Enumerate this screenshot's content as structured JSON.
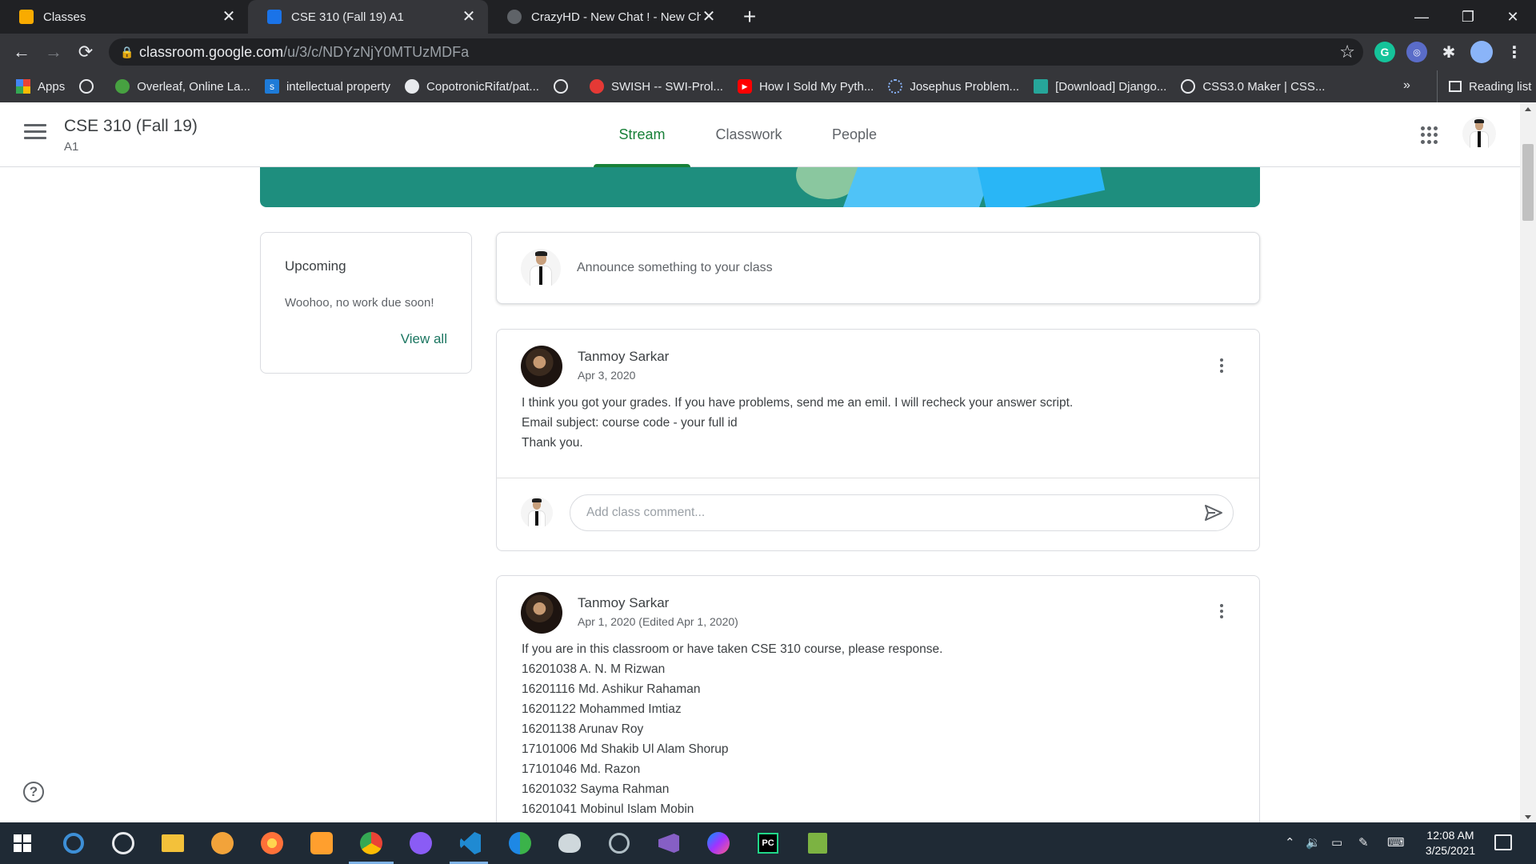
{
  "browser": {
    "tabs": [
      {
        "label": "Classes",
        "close": "✕",
        "color": "#f9ab00"
      },
      {
        "label": "CSE 310 (Fall 19) A1",
        "close": "✕",
        "color": "#1a73e8"
      },
      {
        "label": "CrazyHD - New Chat ! - New Cha",
        "close": "✕",
        "color": "#9aa0a6"
      }
    ],
    "new_tab": "+",
    "window_controls": {
      "minimize": "—",
      "restore": "❐",
      "close": "✕"
    },
    "url_host": "classroom.google.com",
    "url_path": "/u/3/c/NDYzNjY0MTUzMDFa",
    "extensions": {
      "grammarly": "G"
    },
    "bookmarks": [
      {
        "label": "Apps",
        "icon": "apps-grid-icon"
      },
      {
        "label": "",
        "icon": "globe-icon"
      },
      {
        "label": "Overleaf, Online La...",
        "icon": "overleaf-icon"
      },
      {
        "label": "intellectual property",
        "icon": "scribd-icon"
      },
      {
        "label": "CopotronicRifat/pat...",
        "icon": "github-icon"
      },
      {
        "label": "",
        "icon": "globe-icon"
      },
      {
        "label": "SWISH -- SWI-Prol...",
        "icon": "swish-icon"
      },
      {
        "label": "How I Sold My Pyth...",
        "icon": "youtube-icon"
      },
      {
        "label": "Josephus Problem...",
        "icon": "loading-icon"
      },
      {
        "label": "[Download] Django...",
        "icon": "download-site-icon"
      },
      {
        "label": "CSS3.0 Maker | CSS...",
        "icon": "globe-icon"
      }
    ],
    "bookmarks_more": "»",
    "reading_list": "Reading list"
  },
  "classroom": {
    "class_title": "CSE 310 (Fall 19)",
    "class_section": "A1",
    "nav_tabs": [
      {
        "label": "Stream",
        "active": true
      },
      {
        "label": "Classwork",
        "active": false
      },
      {
        "label": "People",
        "active": false
      }
    ],
    "accent": "#188038",
    "upcoming": {
      "title": "Upcoming",
      "text": "Woohoo, no work due soon!",
      "view_all": "View all"
    },
    "announce_placeholder": "Announce something to your class",
    "posts": [
      {
        "author": "Tanmoy Sarkar",
        "date": "Apr 3, 2020",
        "lines": [
          "I think you got your grades. If you have problems, send me an emil. I will recheck your answer script.",
          "Email subject: course code - your full id",
          "Thank you."
        ],
        "comment_placeholder": "Add class comment..."
      },
      {
        "author": "Tanmoy Sarkar",
        "date": "Apr 1, 2020 (Edited Apr 1, 2020)",
        "lines": [
          "If you are in this classroom or have taken CSE 310 course, please response.",
          "16201038 A. N. M Rizwan",
          "16201116 Md. Ashikur Rahaman",
          "16201122 Mohammed Imtiaz",
          "16201138 Arunav Roy",
          "17101006 Md Shakib Ul Alam Shorup",
          "17101046 Md. Razon",
          "16201032 Sayma Rahman",
          "16201041 Mobinul Islam Mobin"
        ]
      }
    ],
    "help": "?"
  },
  "taskbar": {
    "time": "12:08 AM",
    "date": "3/25/2021",
    "apps": [
      {
        "name": "windows-start-icon",
        "color": "#ffffff"
      },
      {
        "name": "search-icon",
        "color": "#3d8fd6"
      },
      {
        "name": "whatsapp-icon",
        "color": "#25d366"
      },
      {
        "name": "file-explorer-icon",
        "color": "#f3c13a"
      },
      {
        "name": "brave-icon",
        "color": "#f2a33a"
      },
      {
        "name": "firefox-icon",
        "color": "#ff7139"
      },
      {
        "name": "photos-icon",
        "color": "#ff9f2e"
      },
      {
        "name": "chrome-icon",
        "color": "#4285f4"
      },
      {
        "name": "github-desktop-icon",
        "color": "#8a5cf5"
      },
      {
        "name": "vscode-icon",
        "color": "#1f8ad2"
      },
      {
        "name": "edge-icon",
        "color": "#3bb34a"
      },
      {
        "name": "paint-3d-icon",
        "color": "#cfd8dc"
      },
      {
        "name": "satellite-icon",
        "color": "#b0bec5"
      },
      {
        "name": "visual-studio-icon",
        "color": "#865fc5"
      },
      {
        "name": "messenger-icon",
        "color": "#7b61ff"
      },
      {
        "name": "pycharm-icon",
        "color": "#21d789"
      },
      {
        "name": "notepad-icon",
        "color": "#7cb342"
      }
    ]
  }
}
